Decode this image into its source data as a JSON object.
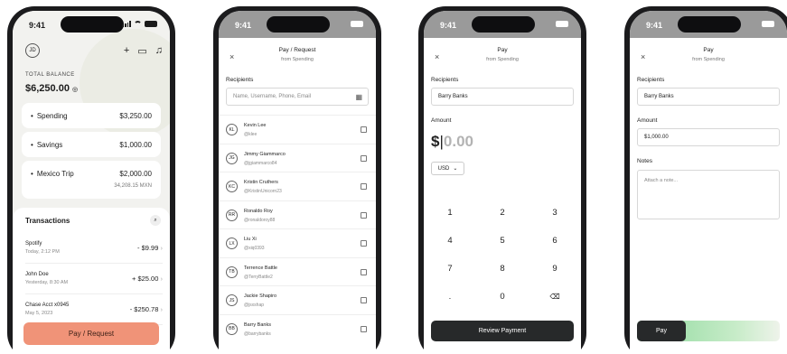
{
  "status": {
    "time": "9:41"
  },
  "home": {
    "avatar_initials": "JD",
    "icons": [
      "plus-icon",
      "card-icon",
      "bell-icon"
    ],
    "balance_label": "TOTAL BALANCE",
    "balance": "$6,250.00",
    "accounts": [
      {
        "name": "Spending",
        "amount": "$3,250.00"
      },
      {
        "name": "Savings",
        "amount": "$1,000.00"
      },
      {
        "name": "Mexico Trip",
        "amount": "$2,000.00",
        "sub": "34,208.15 MXN"
      }
    ],
    "transactions_title": "Transactions",
    "transactions": [
      {
        "name": "Spotify",
        "date": "Today, 2:12 PM",
        "amount": "- $9.99"
      },
      {
        "name": "John Doe",
        "date": "Yesterday, 8:30 AM",
        "amount": "+ $25.00"
      },
      {
        "name": "Chase Acct x0945",
        "date": "May 5, 2023",
        "amount": "- $250.78"
      }
    ],
    "cta": "Pay / Request"
  },
  "recipients_screen": {
    "title": "Pay / Request",
    "subtitle": "from Spending",
    "recipients_label": "Recipients",
    "search_placeholder": "Name, Username, Phone, Email",
    "people": [
      {
        "initials": "KL",
        "name": "Kevin Lee",
        "handle": "@klee"
      },
      {
        "initials": "JG",
        "name": "Jimmy Giammarco",
        "handle": "@jgiammarco84"
      },
      {
        "initials": "KC",
        "name": "Kristin Cruthers",
        "handle": "@KristinUnicorn23"
      },
      {
        "initials": "RR",
        "name": "Ronaldo Roy",
        "handle": "@ronaldoroy88"
      },
      {
        "initials": "LX",
        "name": "Liu Xi",
        "handle": "@xiq0393"
      },
      {
        "initials": "TB",
        "name": "Terrence Battle",
        "handle": "@TerryBattle2"
      },
      {
        "initials": "JS",
        "name": "Jackie Shapiro",
        "handle": "@jsxshap"
      },
      {
        "initials": "BB",
        "name": "Barry Banks",
        "handle": "@barrybanks"
      }
    ]
  },
  "amount_screen": {
    "title": "Pay",
    "subtitle": "from Spending",
    "recipients_label": "Recipients",
    "recipient_value": "Barry Banks",
    "amount_label": "Amount",
    "currency_symbol": "$",
    "amount_value": "0.00",
    "currency": "USD",
    "keys": [
      "1",
      "2",
      "3",
      "4",
      "5",
      "6",
      "7",
      "8",
      "9",
      ".",
      "0",
      "⌫"
    ],
    "cta": "Review Payment"
  },
  "confirm_screen": {
    "title": "Pay",
    "subtitle": "from Spending",
    "recipients_label": "Recipients",
    "recipient_value": "Barry Banks",
    "amount_label": "Amount",
    "amount_value": "$1,000.00",
    "notes_label": "Notes",
    "notes_placeholder": "Attach a note...",
    "slider_label": "Pay",
    "slider_progress": 0.2
  }
}
